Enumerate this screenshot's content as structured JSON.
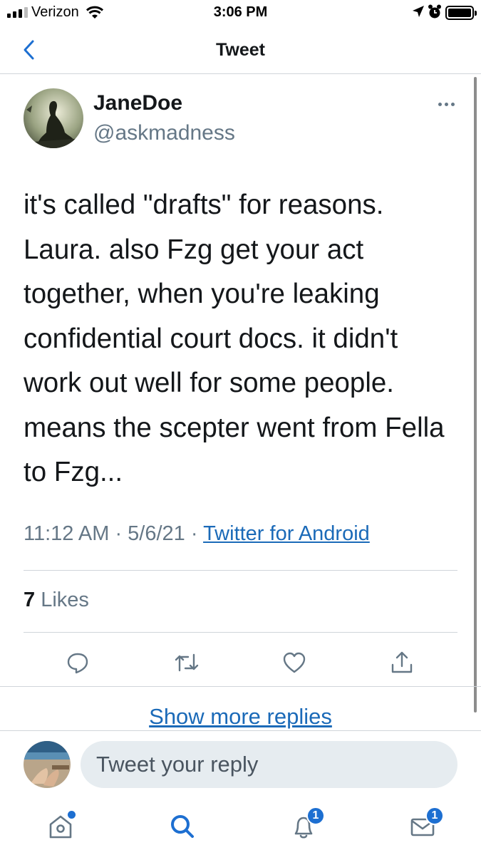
{
  "status_bar": {
    "carrier": "Verizon",
    "time": "3:06 PM",
    "signal_icon": "cellular-signal-icon",
    "wifi_icon": "wifi-icon",
    "location_icon": "location-arrow-icon",
    "alarm_icon": "alarm-clock-icon",
    "battery_icon": "battery-icon"
  },
  "header": {
    "title": "Tweet",
    "back_icon": "chevron-left-icon"
  },
  "tweet": {
    "author_name": "JaneDoe",
    "author_handle": "@askmadness",
    "text": "it's called \"drafts\" for reasons. Laura. also Fzg get your act together, when you're leaking confidential court docs. it didn't work out well for some people. means the scepter went from Fella to Fzg...",
    "time": "11:12 AM",
    "separator": " · ",
    "date": "5/6/21",
    "source": "Twitter for Android",
    "likes_count": "7",
    "likes_label": "Likes"
  },
  "actions": [
    {
      "icon": "reply-icon"
    },
    {
      "icon": "retweet-icon"
    },
    {
      "icon": "heart-icon"
    },
    {
      "icon": "share-icon"
    }
  ],
  "show_more_label": "Show more replies",
  "reply": {
    "placeholder": "Tweet your reply"
  },
  "tab_bar": {
    "home_icon": "home-icon",
    "search_icon": "search-icon",
    "notifications_icon": "bell-icon",
    "notifications_badge": "1",
    "messages_icon": "envelope-icon",
    "messages_badge": "1"
  },
  "colors": {
    "accent": "#1d6fd1",
    "link": "#1b6ab8",
    "text_primary": "#14171a",
    "text_secondary": "#657786",
    "divider": "#d0d5da",
    "input_bg": "#e6ecf0"
  }
}
